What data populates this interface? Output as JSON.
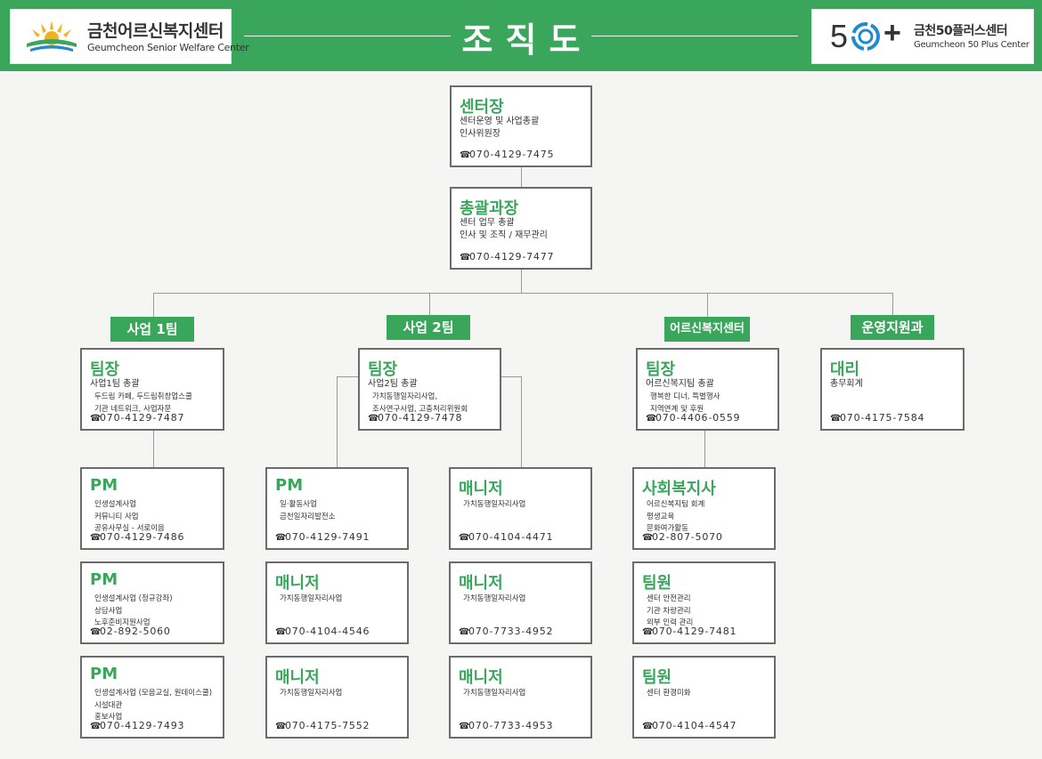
{
  "header": {
    "title": "조직도",
    "left_logo": {
      "ko": "금천어르신복지센터",
      "en": "Geumcheon Senior Welfare Center"
    },
    "right_logo": {
      "mark": "5",
      "plus": "+",
      "ko": "금천50플러스센터",
      "en": "Geumcheon 50 Plus Center"
    },
    "colors": {
      "brand_green": "#3aa65c"
    }
  },
  "top": [
    {
      "title": "센터장",
      "lines": [
        "센터운영 및 사업총괄",
        "인사위원장"
      ],
      "phone": "070-4129-7475"
    },
    {
      "title": "총괄과장",
      "lines": [
        "센터 업무 총괄",
        "인사 및 조직 / 재무관리"
      ],
      "phone": "070-4129-7477"
    }
  ],
  "departments": [
    "사업 1팀",
    "사업 2팀",
    "어르신복지센터",
    "운영지원과"
  ],
  "leaders": [
    {
      "title": "팀장",
      "role": "사업1팀 총괄",
      "lines": [
        "두드림 카페, 두드림취창업스쿨",
        "기관 네트워크, 사업자문"
      ],
      "phone": "070-4129-7487"
    },
    {
      "title": "팀장",
      "role": "사업2팀 총괄",
      "lines": [
        "가치동행일자리사업,",
        "조사연구사업, 고충처리위원회"
      ],
      "phone": "070-4129-7478"
    },
    {
      "title": "팀장",
      "role": "어르신복지팀 총괄",
      "lines": [
        "행복한 디너, 특별행사",
        "지역연계 및 후원"
      ],
      "phone": "070-4406-0559"
    },
    {
      "title": "대리",
      "role": "총무회계",
      "lines": [],
      "phone": "070-4175-7584"
    }
  ],
  "team1": [
    {
      "title": "PM",
      "lines": [
        "인생설계사업",
        "커뮤니티 사업",
        "공유사무실 - 서로이음"
      ],
      "phone": "070-4129-7486"
    },
    {
      "title": "PM",
      "lines": [
        "인생설계사업 (정규강좌)",
        "상담사업",
        "노후준비지원사업"
      ],
      "phone": "02-892-5060"
    },
    {
      "title": "PM",
      "lines": [
        "인생설계사업 (모음교실, 원데이스쿨)",
        "시설대관",
        "홍보사업"
      ],
      "phone": "070-4129-7493"
    }
  ],
  "team2a": [
    {
      "title": "PM",
      "lines": [
        "일·활동사업",
        "금천일자리발전소"
      ],
      "phone": "070-4129-7491"
    },
    {
      "title": "매니저",
      "lines": [
        "가치동행일자리사업"
      ],
      "phone": "070-4104-4546"
    },
    {
      "title": "매니저",
      "lines": [
        "가치동행일자리사업"
      ],
      "phone": "070-4175-7552"
    }
  ],
  "team2b": [
    {
      "title": "매니저",
      "lines": [
        "가치동행일자리사업"
      ],
      "phone": "070-4104-4471"
    },
    {
      "title": "매니저",
      "lines": [
        "가치동행일자리사업"
      ],
      "phone": "070-7733-4952"
    },
    {
      "title": "매니저",
      "lines": [
        "가치동행일자리사업"
      ],
      "phone": "070-7733-4953"
    }
  ],
  "team3": [
    {
      "title": "사회복지사",
      "lines": [
        "어르신복지팀 회계",
        "평생교육",
        "문화여가활동"
      ],
      "phone": "02-807-5070"
    },
    {
      "title": "팀원",
      "lines": [
        "센터 안전관리",
        "기관 차량관리",
        "외부 인력 관리"
      ],
      "phone": "070-4129-7481"
    },
    {
      "title": "팀원",
      "lines": [
        "센터 환경미화"
      ],
      "phone": "070-4104-4547"
    }
  ]
}
